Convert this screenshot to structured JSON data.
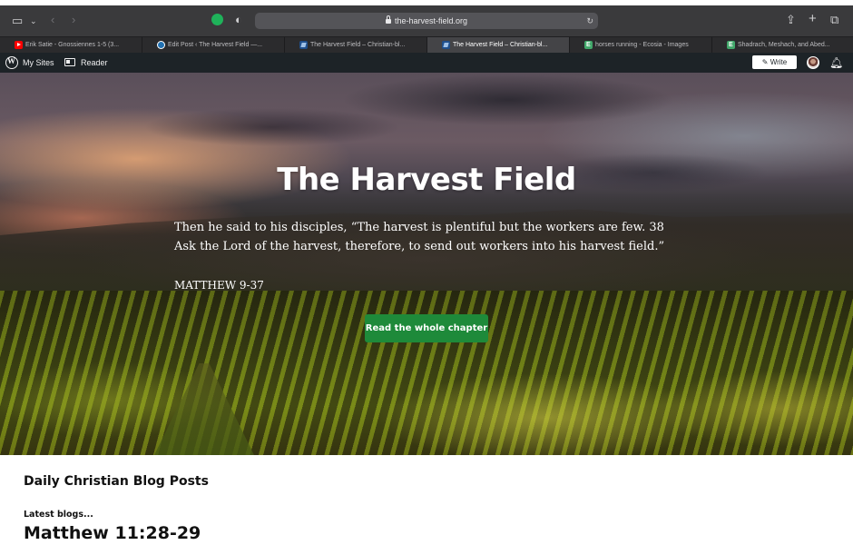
{
  "browser": {
    "url": "the-harvest-field.org",
    "tabs": [
      {
        "title": "Erik Satie - Gnossiennes 1-5 (3...",
        "favicon": "youtube-icon",
        "active": false
      },
      {
        "title": "Edit Post ‹ The Harvest Field —...",
        "favicon": "wordpress-icon",
        "active": false
      },
      {
        "title": "The Harvest Field – Christian-bl...",
        "favicon": "site-icon",
        "active": false
      },
      {
        "title": "The Harvest Field – Christian-bl...",
        "favicon": "site-icon",
        "active": true
      },
      {
        "title": "horses running - Ecosia - Images",
        "favicon": "ecosia-icon",
        "active": false
      },
      {
        "title": "Shadrach, Meshach, and Abed...",
        "favicon": "ecosia-icon",
        "active": false
      }
    ]
  },
  "adminbar": {
    "my_sites": "My Sites",
    "reader": "Reader",
    "write": "Write"
  },
  "hero": {
    "title": "The Harvest Field",
    "quote": "Then he said to his disciples, “The harvest is plentiful but the workers are few. 38 Ask the Lord of the harvest, therefore, to send out workers into his harvest field.”",
    "reference": "MATTHEW 9-37",
    "cta": "Read the whole chapter"
  },
  "content": {
    "section_title": "Daily Christian Blog Posts",
    "latest_label": "Latest blogs...",
    "post_title": "Matthew 11:28-29"
  },
  "colors": {
    "cta_green": "#1e8a3a",
    "adminbar": "#1d2327",
    "toolbar": "#3a3a3c"
  }
}
